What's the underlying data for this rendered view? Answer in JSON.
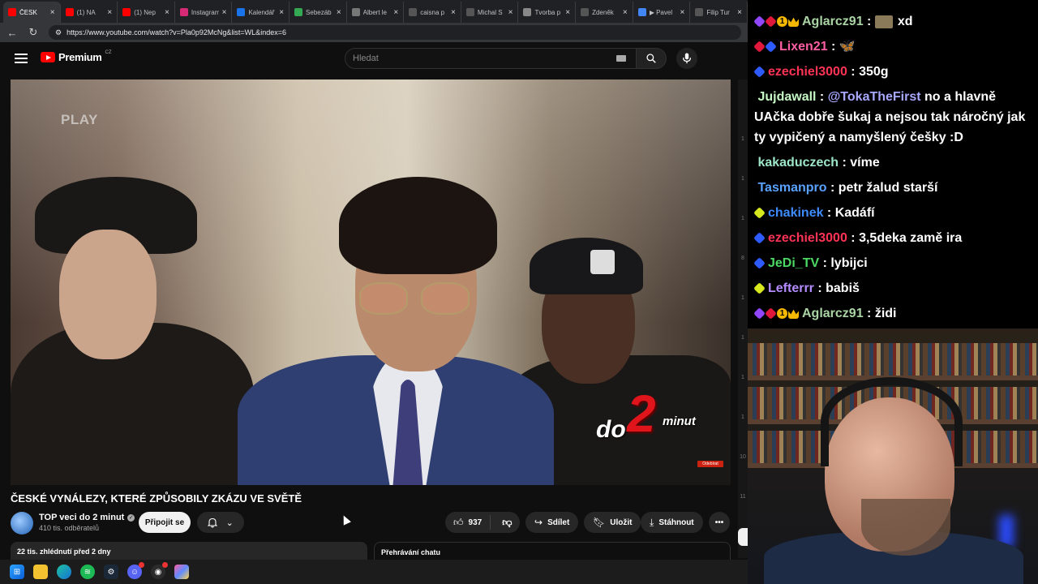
{
  "browser": {
    "tabs": [
      {
        "label": "ČESK",
        "color": "#ff0000",
        "active": true
      },
      {
        "label": "(1) NA",
        "color": "#ff0000"
      },
      {
        "label": "(1) Nep",
        "color": "#ff0000"
      },
      {
        "label": "Instagram",
        "color": "#d62976"
      },
      {
        "label": "Kalendář",
        "color": "#1a73e8"
      },
      {
        "label": "Sebezáb",
        "color": "#34a853"
      },
      {
        "label": "Albert le",
        "color": "#777777"
      },
      {
        "label": "caisna p",
        "color": "#555555"
      },
      {
        "label": "Michal S",
        "color": "#555555"
      },
      {
        "label": "Tvorba p",
        "color": "#888888"
      },
      {
        "label": "Zdeněk",
        "color": "#555555"
      },
      {
        "label": "▶ Pavel",
        "color": "#4285f4"
      },
      {
        "label": "Filip Tur",
        "color": "#555555"
      }
    ],
    "url": "https://www.youtube.com/watch?v=Pla0p92McNg&list=WL&index=6"
  },
  "youtube": {
    "brand": "Premium",
    "country": "CZ",
    "search_placeholder": "Hledat"
  },
  "video": {
    "overlay_logo": "PLAY",
    "watermark_do": "do",
    "watermark_num": "2",
    "watermark_minut": "minut",
    "subscribe_badge": "Odebírat",
    "title": "ČESKÉ VYNÁLEZY, KTERÉ ZPŮSOBILY ZKÁZU VE SVĚTĚ",
    "channel_name": "TOP veci do 2 minut",
    "channel_subs": "410 tis. odběratelů",
    "join_label": "Připojit se",
    "likes": "937",
    "share_label": "Sdílet",
    "save_label": "Uložit",
    "download_label": "Stáhnout",
    "views_date": "22 tis. zhlédnutí  před 2 dny",
    "chat_replay": "Přehrávání chatu"
  },
  "rail": {
    "marks": [
      "1",
      "1",
      "1",
      "8",
      "1",
      "1",
      "1",
      "1",
      "10",
      "11"
    ]
  },
  "chat": {
    "messages": [
      {
        "badges": [
          "cube",
          "red",
          "one",
          "crown"
        ],
        "user": "Aglarcz91",
        "color": "#aad4a4",
        "text": "xd",
        "emote": true
      },
      {
        "badges": [
          "red",
          "blue"
        ],
        "user": "Lixen21",
        "color": "#ff5fa2",
        "text": "🦋"
      },
      {
        "badges": [
          "blue"
        ],
        "user": "ezechiel3000",
        "color": "#ff3355",
        "text": "350g"
      },
      {
        "badges": [],
        "user": "Jujdawall",
        "color": "#c5f7c5",
        "mention": "@TokaTheFirst",
        "text": "no a hlavně UAčka dobře šukaj a nejsou tak náročný jak ty vypičený a namyšlený češky :D"
      },
      {
        "badges": [],
        "user": "kakaduczech",
        "color": "#9ee6c8",
        "text": "víme"
      },
      {
        "badges": [],
        "user": "Tasmanpro",
        "color": "#5aa2ff",
        "text": "petr žalud starší"
      },
      {
        "badges": [
          "yel"
        ],
        "user": "chakinek",
        "color": "#3d8bff",
        "text": "Kadáfí"
      },
      {
        "badges": [
          "blue"
        ],
        "user": "ezechiel3000",
        "color": "#ff3355",
        "text": "3,5deka zamě ira"
      },
      {
        "badges": [
          "blue"
        ],
        "user": "JeDi_TV",
        "color": "#4cd964",
        "text": "lybijci"
      },
      {
        "badges": [
          "yel"
        ],
        "user": "Lefterrr",
        "color": "#b48cff",
        "text": "babiš"
      },
      {
        "badges": [
          "cube",
          "red",
          "one",
          "crown"
        ],
        "user": "Aglarcz91",
        "color": "#aad4a4",
        "text": "židi"
      }
    ]
  }
}
